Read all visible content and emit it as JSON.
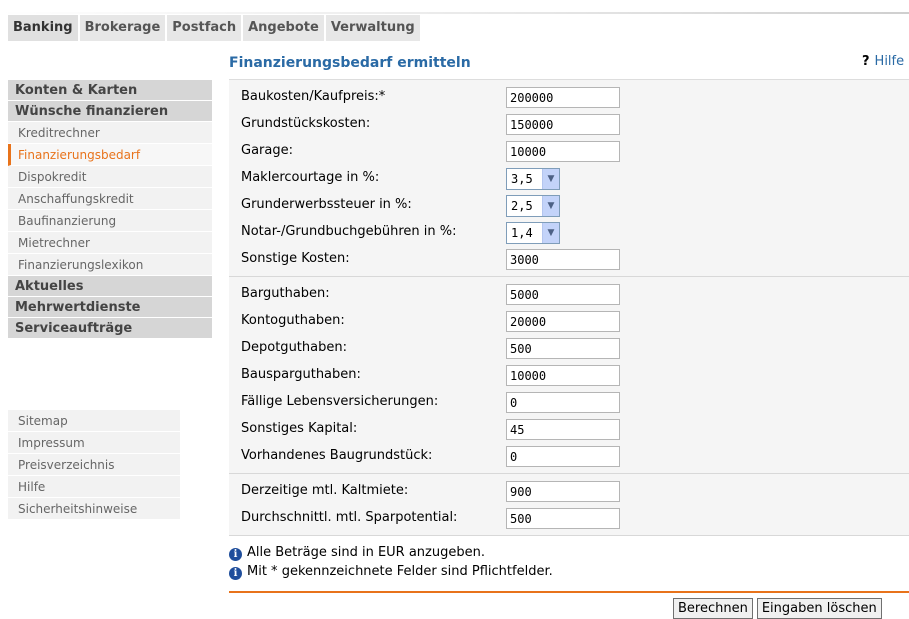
{
  "tabs": [
    "Banking",
    "Brokerage",
    "Postfach",
    "Angebote",
    "Verwaltung"
  ],
  "sidebar": {
    "heads_top": [
      "Konten & Karten",
      "Wünsche finanzieren"
    ],
    "items": [
      "Kreditrechner",
      "Finanzierungsbedarf",
      "Dispokredit",
      "Anschaffungskredit",
      "Baufinanzierung",
      "Mietrechner",
      "Finanzierungslexikon"
    ],
    "heads_bottom": [
      "Aktuelles",
      "Mehrwertdienste",
      "Serviceaufträge"
    ],
    "footer_items": [
      "Sitemap",
      "Impressum",
      "Preisverzeichnis",
      "Hilfe",
      "Sicherheitshinweise"
    ]
  },
  "page": {
    "title": "Finanzierungsbedarf ermitteln",
    "help_label": "Hilfe",
    "help_icon": "?"
  },
  "form": {
    "group1": [
      {
        "label": "Baukosten/Kaufpreis:*",
        "value": "200000"
      },
      {
        "label": "Grundstückskosten:",
        "value": "150000"
      },
      {
        "label": "Garage:",
        "value": "10000"
      },
      {
        "label": "Maklercourtage in %:",
        "select": "3,5"
      },
      {
        "label": "Grunderwerbssteuer in %:",
        "select": "2,5"
      },
      {
        "label": "Notar-/Grundbuchgebühren in %:",
        "select": "1,4"
      },
      {
        "label": "Sonstige Kosten:",
        "value": "3000"
      }
    ],
    "group2": [
      {
        "label": "Barguthaben:",
        "value": "5000"
      },
      {
        "label": "Kontoguthaben:",
        "value": "20000"
      },
      {
        "label": "Depotguthaben:",
        "value": "500"
      },
      {
        "label": "Bausparguthaben:",
        "value": "10000"
      },
      {
        "label": "Fällige Lebensversicherungen:",
        "value": "0"
      },
      {
        "label": "Sonstiges Kapital:",
        "value": "45"
      },
      {
        "label": "Vorhandenes Baugrundstück:",
        "value": "0"
      }
    ],
    "group3": [
      {
        "label": "Derzeitige mtl. Kaltmiete:",
        "value": "900"
      },
      {
        "label": "Durchschnittl. mtl. Sparpotential:",
        "value": "500"
      }
    ]
  },
  "notes": [
    "Alle Beträge sind in EUR anzugeben.",
    "Mit * gekennzeichnete Felder sind Pflichtfelder."
  ],
  "buttons": {
    "calculate": "Berechnen",
    "reset": "Eingaben löschen"
  }
}
